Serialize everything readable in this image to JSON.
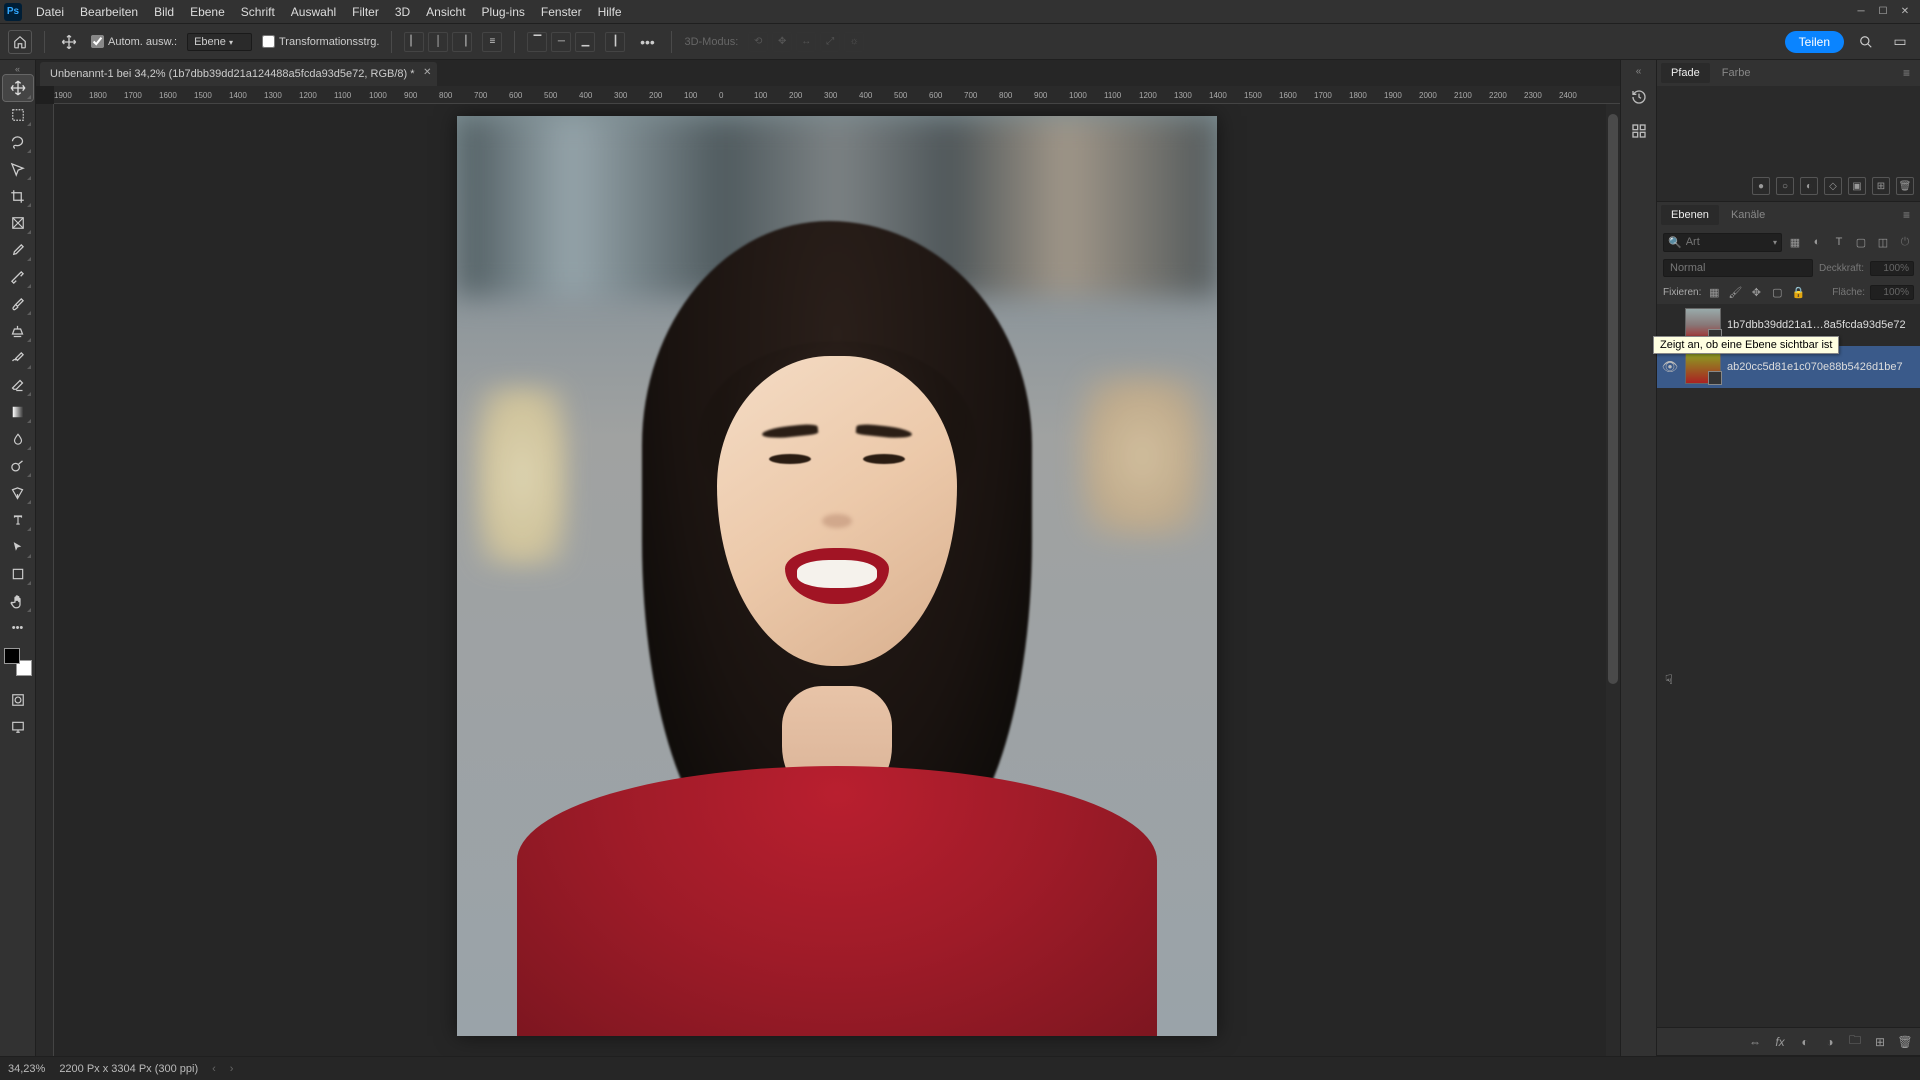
{
  "menubar": {
    "items": [
      "Datei",
      "Bearbeiten",
      "Bild",
      "Ebene",
      "Schrift",
      "Auswahl",
      "Filter",
      "3D",
      "Ansicht",
      "Plug-ins",
      "Fenster",
      "Hilfe"
    ]
  },
  "optbar": {
    "auto_select_label": "Autom. ausw.:",
    "select_target": "Ebene",
    "transform_label": "Transformationsstrg.",
    "mode3d_label": "3D-Modus:",
    "share_label": "Teilen"
  },
  "document": {
    "tab_title": "Unbenannt-1 bei 34,2% (1b7dbb39dd21a124488a5fcda93d5e72, RGB/8) *"
  },
  "ruler_h_values": [
    "1900",
    "1800",
    "1700",
    "1600",
    "1500",
    "1400",
    "1300",
    "1200",
    "1100",
    "1000",
    "900",
    "800",
    "700",
    "600",
    "500",
    "400",
    "300",
    "200",
    "100",
    "0",
    "100",
    "200",
    "300",
    "400",
    "500",
    "600",
    "700",
    "800",
    "900",
    "1000",
    "1100",
    "1200",
    "1300",
    "1400",
    "1500",
    "1600",
    "1700",
    "1800",
    "1900",
    "2000",
    "2100",
    "2200",
    "2300",
    "2400"
  ],
  "panels": {
    "top_tabs": [
      "Pfade",
      "Farbe"
    ],
    "layers_tabs": [
      "Ebenen",
      "Kanäle"
    ],
    "search_placeholder": "Art",
    "blend_mode": "Normal",
    "opacity_label": "Deckkraft:",
    "opacity_value": "100%",
    "lock_label": "Fixieren:",
    "fill_label": "Fläche:",
    "fill_value": "100%"
  },
  "layers": [
    {
      "name": "1b7dbb39dd21a1…8a5fcda93d5e72",
      "visible": false,
      "active": false
    },
    {
      "name": "ab20cc5d81e1c070e88b5426d1be7",
      "visible": true,
      "active": true
    }
  ],
  "tooltip": "Zeigt an, ob eine Ebene sichtbar ist",
  "statusbar": {
    "zoom": "34,23%",
    "dims": "2200 Px x 3304 Px (300 ppi)"
  }
}
